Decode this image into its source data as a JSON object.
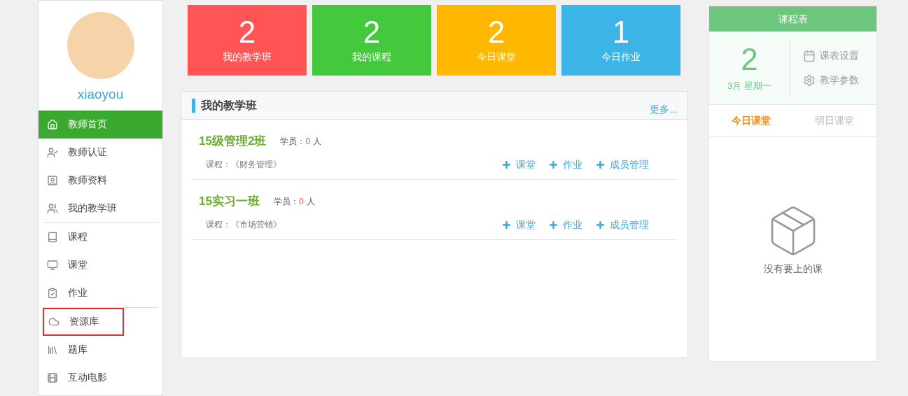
{
  "profile": {
    "username": "xiaoyou"
  },
  "sidebar": {
    "groups": [
      {
        "items": [
          {
            "label": "教师首页",
            "selected": true,
            "highlighted": false
          },
          {
            "label": "教师认证",
            "selected": false,
            "highlighted": false
          },
          {
            "label": "教师资料",
            "selected": false,
            "highlighted": false
          },
          {
            "label": "我的教学班",
            "selected": false,
            "highlighted": false
          }
        ]
      },
      {
        "items": [
          {
            "label": "课程",
            "selected": false,
            "highlighted": false
          },
          {
            "label": "课堂",
            "selected": false,
            "highlighted": false
          },
          {
            "label": "作业",
            "selected": false,
            "highlighted": false
          }
        ]
      },
      {
        "items": [
          {
            "label": "资源库",
            "selected": false,
            "highlighted": true
          },
          {
            "label": "题库",
            "selected": false,
            "highlighted": false
          },
          {
            "label": "互动电影",
            "selected": false,
            "highlighted": false
          }
        ]
      }
    ]
  },
  "stats": [
    {
      "value": "2",
      "label": "我的教学班",
      "color": "#ff5555"
    },
    {
      "value": "2",
      "label": "我的课程",
      "color": "#44c83c"
    },
    {
      "value": "2",
      "label": "今日课堂",
      "color": "#ffb700"
    },
    {
      "value": "1",
      "label": "今日作业",
      "color": "#3cb5e6"
    }
  ],
  "classes_panel": {
    "title": "我的教学班",
    "more": "更多...",
    "classes": [
      {
        "name": "15级管理2班",
        "students_label": "学员：",
        "students_count": "0",
        "students_unit": "人",
        "course": "课程：《财务管理》",
        "actions": [
          "课堂",
          "作业",
          "成员管理"
        ]
      },
      {
        "name": "15实习一班",
        "students_label": "学员：",
        "students_count": "0",
        "students_unit": "人",
        "course": "课程：《市场营销》",
        "actions": [
          "课堂",
          "作业",
          "成员管理"
        ]
      }
    ]
  },
  "schedule": {
    "title": "课程表",
    "day": "2",
    "date": "3月 星期一",
    "links": [
      {
        "label": "课表设置"
      },
      {
        "label": "教学参数"
      }
    ],
    "tabs": [
      {
        "label": "今日课堂",
        "selected": true
      },
      {
        "label": "明日课堂",
        "selected": false
      }
    ],
    "empty_text": "没有要上的课"
  }
}
